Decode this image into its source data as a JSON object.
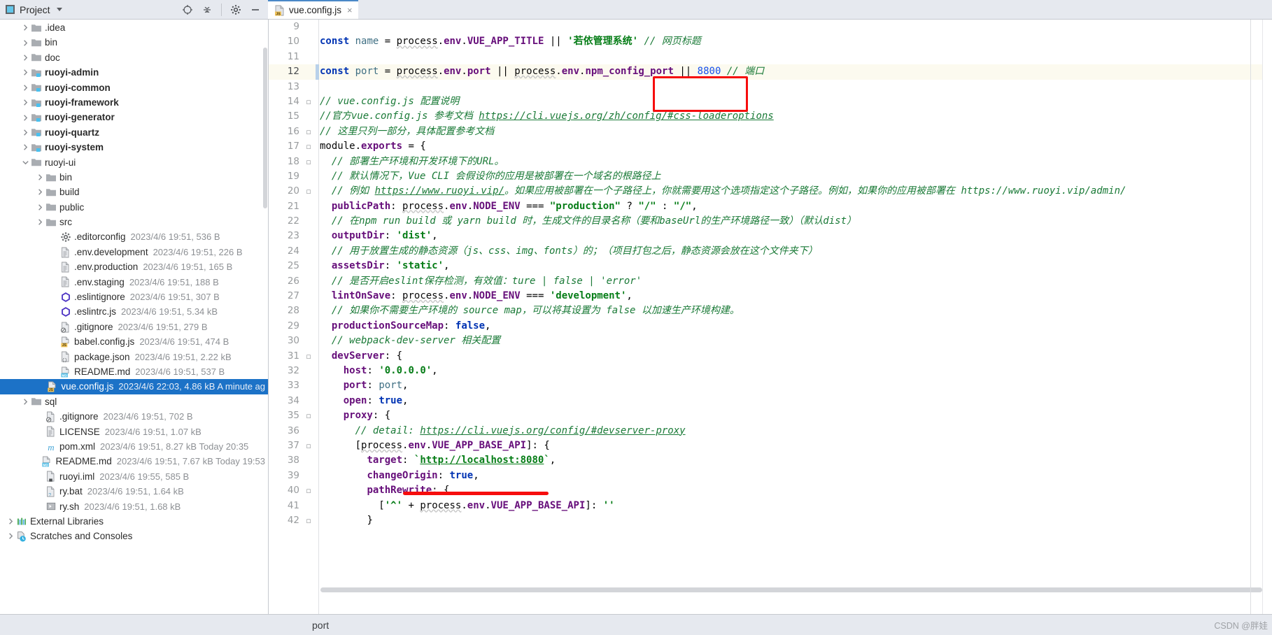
{
  "panel": {
    "title": "Project",
    "icons": [
      "locate-icon",
      "collapse-all-icon",
      "gear-icon",
      "minimize-icon"
    ]
  },
  "tab": {
    "label": "vue.config.js",
    "icon": "js-file-icon",
    "close": "×"
  },
  "tree": [
    {
      "name": ".idea",
      "meta": "",
      "icon": "folder",
      "arrow": "right",
      "depth": 1,
      "bold": false
    },
    {
      "name": "bin",
      "meta": "",
      "icon": "folder",
      "arrow": "right",
      "depth": 1,
      "bold": false
    },
    {
      "name": "doc",
      "meta": "",
      "icon": "folder",
      "arrow": "right",
      "depth": 1,
      "bold": false
    },
    {
      "name": "ruoyi-admin",
      "meta": "",
      "icon": "module",
      "arrow": "right",
      "depth": 1,
      "bold": true
    },
    {
      "name": "ruoyi-common",
      "meta": "",
      "icon": "module",
      "arrow": "right",
      "depth": 1,
      "bold": true
    },
    {
      "name": "ruoyi-framework",
      "meta": "",
      "icon": "module",
      "arrow": "right",
      "depth": 1,
      "bold": true
    },
    {
      "name": "ruoyi-generator",
      "meta": "",
      "icon": "module",
      "arrow": "right",
      "depth": 1,
      "bold": true
    },
    {
      "name": "ruoyi-quartz",
      "meta": "",
      "icon": "module",
      "arrow": "right",
      "depth": 1,
      "bold": true
    },
    {
      "name": "ruoyi-system",
      "meta": "",
      "icon": "module",
      "arrow": "right",
      "depth": 1,
      "bold": true
    },
    {
      "name": "ruoyi-ui",
      "meta": "",
      "icon": "folder",
      "arrow": "down",
      "depth": 1,
      "bold": false
    },
    {
      "name": "bin",
      "meta": "",
      "icon": "folder",
      "arrow": "right",
      "depth": 2,
      "bold": false
    },
    {
      "name": "build",
      "meta": "",
      "icon": "folder",
      "arrow": "right",
      "depth": 2,
      "bold": false
    },
    {
      "name": "public",
      "meta": "",
      "icon": "folder",
      "arrow": "right",
      "depth": 2,
      "bold": false
    },
    {
      "name": "src",
      "meta": "",
      "icon": "folder",
      "arrow": "right",
      "depth": 2,
      "bold": false
    },
    {
      "name": ".editorconfig",
      "meta": "2023/4/6 19:51, 536 B",
      "icon": "gear-file",
      "arrow": "none",
      "depth": 3,
      "bold": false
    },
    {
      "name": ".env.development",
      "meta": "2023/4/6 19:51, 226 B",
      "icon": "text-file",
      "arrow": "none",
      "depth": 3,
      "bold": false
    },
    {
      "name": ".env.production",
      "meta": "2023/4/6 19:51, 165 B",
      "icon": "text-file",
      "arrow": "none",
      "depth": 3,
      "bold": false
    },
    {
      "name": ".env.staging",
      "meta": "2023/4/6 19:51, 188 B",
      "icon": "text-file",
      "arrow": "none",
      "depth": 3,
      "bold": false
    },
    {
      "name": ".eslintignore",
      "meta": "2023/4/6 19:51, 307 B",
      "icon": "eslint-file",
      "arrow": "none",
      "depth": 3,
      "bold": false
    },
    {
      "name": ".eslintrc.js",
      "meta": "2023/4/6 19:51, 5.34 kB",
      "icon": "eslint-file",
      "arrow": "none",
      "depth": 3,
      "bold": false
    },
    {
      "name": ".gitignore",
      "meta": "2023/4/6 19:51, 279 B",
      "icon": "git-file",
      "arrow": "none",
      "depth": 3,
      "bold": false
    },
    {
      "name": "babel.config.js",
      "meta": "2023/4/6 19:51, 474 B",
      "icon": "js-file",
      "arrow": "none",
      "depth": 3,
      "bold": false
    },
    {
      "name": "package.json",
      "meta": "2023/4/6 19:51, 2.22 kB",
      "icon": "json-file",
      "arrow": "none",
      "depth": 3,
      "bold": false
    },
    {
      "name": "README.md",
      "meta": "2023/4/6 19:51, 537 B",
      "icon": "md-file",
      "arrow": "none",
      "depth": 3,
      "bold": false
    },
    {
      "name": "vue.config.js",
      "meta": "2023/4/6 22:03, 4.86 kB A minute ag",
      "icon": "js-file",
      "arrow": "none",
      "depth": 3,
      "bold": false,
      "selected": true
    },
    {
      "name": "sql",
      "meta": "",
      "icon": "folder",
      "arrow": "right",
      "depth": 1,
      "bold": false
    },
    {
      "name": ".gitignore",
      "meta": "2023/4/6 19:51, 702 B",
      "icon": "git-file",
      "arrow": "none",
      "depth": 2,
      "bold": false
    },
    {
      "name": "LICENSE",
      "meta": "2023/4/6 19:51, 1.07 kB",
      "icon": "text-file",
      "arrow": "none",
      "depth": 2,
      "bold": false
    },
    {
      "name": "pom.xml",
      "meta": "2023/4/6 19:51, 8.27 kB Today 20:35",
      "icon": "maven-file",
      "arrow": "none",
      "depth": 2,
      "bold": false
    },
    {
      "name": "README.md",
      "meta": "2023/4/6 19:51, 7.67 kB Today 19:53",
      "icon": "md-file",
      "arrow": "none",
      "depth": 2,
      "bold": false
    },
    {
      "name": "ruoyi.iml",
      "meta": "2023/4/6 19:55, 585 B",
      "icon": "iml-file",
      "arrow": "none",
      "depth": 2,
      "bold": false
    },
    {
      "name": "ry.bat",
      "meta": "2023/4/6 19:51, 1.64 kB",
      "icon": "bat-file",
      "arrow": "none",
      "depth": 2,
      "bold": false
    },
    {
      "name": "ry.sh",
      "meta": "2023/4/6 19:51, 1.68 kB",
      "icon": "sh-file",
      "arrow": "none",
      "depth": 2,
      "bold": false
    },
    {
      "name": "External Libraries",
      "meta": "",
      "icon": "libraries",
      "arrow": "right",
      "depth": 0,
      "bold": false
    },
    {
      "name": "Scratches and Consoles",
      "meta": "",
      "icon": "scratches",
      "arrow": "right",
      "depth": 0,
      "bold": false
    }
  ],
  "editor": {
    "first_line": 9,
    "current_line": 12,
    "lines": [
      {
        "n": 9,
        "fold": "",
        "text": ""
      },
      {
        "n": 10,
        "fold": "",
        "text": "const name = process.env.VUE_APP_TITLE || '若依管理系统' // 网页标题"
      },
      {
        "n": 11,
        "fold": "",
        "text": ""
      },
      {
        "n": 12,
        "fold": "",
        "text": "const port = process.env.port || process.env.npm_config_port || 8800 // 端口"
      },
      {
        "n": 13,
        "fold": "",
        "text": ""
      },
      {
        "n": 14,
        "fold": "minus",
        "text": "// vue.config.js 配置说明"
      },
      {
        "n": 15,
        "fold": "",
        "text": "//官方vue.config.js 参考文档 https://cli.vuejs.org/zh/config/#css-loaderoptions"
      },
      {
        "n": 16,
        "fold": "minus",
        "text": "// 这里只列一部分，具体配置参考文档"
      },
      {
        "n": 17,
        "fold": "minus",
        "text": "module.exports = {"
      },
      {
        "n": 18,
        "fold": "minus",
        "text": "  // 部署生产环境和开发环境下的URL。"
      },
      {
        "n": 19,
        "fold": "",
        "text": "  // 默认情况下，Vue CLI 会假设你的应用是被部署在一个域名的根路径上"
      },
      {
        "n": 20,
        "fold": "minus",
        "text": "  // 例如 https://www.ruoyi.vip/。如果应用被部署在一个子路径上，你就需要用这个选项指定这个子路径。例如，如果你的应用被部署在 https://www.ruoyi.vip/admin/"
      },
      {
        "n": 21,
        "fold": "",
        "text": "  publicPath: process.env.NODE_ENV === \"production\" ? \"/\" : \"/\","
      },
      {
        "n": 22,
        "fold": "",
        "text": "  // 在npm run build 或 yarn build 时，生成文件的目录名称（要和baseUrl的生产环境路径一致）（默认dist）"
      },
      {
        "n": 23,
        "fold": "",
        "text": "  outputDir: 'dist',"
      },
      {
        "n": 24,
        "fold": "",
        "text": "  // 用于放置生成的静态资源（js、css、img、fonts）的；（项目打包之后，静态资源会放在这个文件夹下）"
      },
      {
        "n": 25,
        "fold": "",
        "text": "  assetsDir: 'static',"
      },
      {
        "n": 26,
        "fold": "",
        "text": "  // 是否开启eslint保存检测，有效值：ture | false | 'error'"
      },
      {
        "n": 27,
        "fold": "",
        "text": "  lintOnSave: process.env.NODE_ENV === 'development',"
      },
      {
        "n": 28,
        "fold": "",
        "text": "  // 如果你不需要生产环境的 source map，可以将其设置为 false 以加速生产环境构建。"
      },
      {
        "n": 29,
        "fold": "",
        "text": "  productionSourceMap: false,"
      },
      {
        "n": 30,
        "fold": "",
        "text": "  // webpack-dev-server 相关配置"
      },
      {
        "n": 31,
        "fold": "minus",
        "text": "  devServer: {"
      },
      {
        "n": 32,
        "fold": "",
        "text": "    host: '0.0.0.0',"
      },
      {
        "n": 33,
        "fold": "",
        "text": "    port: port,"
      },
      {
        "n": 34,
        "fold": "",
        "text": "    open: true,"
      },
      {
        "n": 35,
        "fold": "minus",
        "text": "    proxy: {"
      },
      {
        "n": 36,
        "fold": "",
        "text": "      // detail: https://cli.vuejs.org/config/#devserver-proxy"
      },
      {
        "n": 37,
        "fold": "minus",
        "text": "      [process.env.VUE_APP_BASE_API]: {"
      },
      {
        "n": 38,
        "fold": "",
        "text": "        target: `http://localhost:8080`,"
      },
      {
        "n": 39,
        "fold": "",
        "text": "        changeOrigin: true,"
      },
      {
        "n": 40,
        "fold": "minus",
        "text": "        pathRewrite: {"
      },
      {
        "n": 41,
        "fold": "",
        "text": "          ['^' + process.env.VUE_APP_BASE_API]: ''"
      },
      {
        "n": 42,
        "fold": "minus",
        "text": "        }"
      }
    ],
    "annotations": {
      "port_box_value": "8800 // 端口",
      "target_underline_value": "http://localhost:8080",
      "highlight_color": "#f60d0d"
    }
  },
  "status": {
    "text": "port"
  },
  "watermark": "CSDN @胖娃"
}
